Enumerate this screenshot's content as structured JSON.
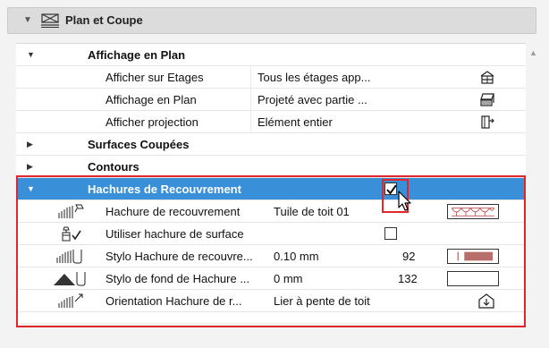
{
  "panel": {
    "title": "Plan et Coupe",
    "icon": "plan-section-icon"
  },
  "groups": {
    "affichage": "Affichage en Plan",
    "surfaces": "Surfaces Coupées",
    "contours": "Contours",
    "hachures": "Hachures de Recouvrement"
  },
  "affichage_rows": [
    {
      "label": "Afficher sur Etages",
      "value": "Tous les étages app...",
      "icon": "all-floors-icon"
    },
    {
      "label": "Affichage en Plan",
      "value": "Projeté avec partie ...",
      "icon": "projected-view-icon"
    },
    {
      "label": "Afficher projection",
      "value": "Elément entier",
      "icon": "entire-element-icon"
    }
  ],
  "hachures_checked": true,
  "hachures_rows": [
    {
      "label": "Hachure de recouvrement",
      "value": "Tuile de toit 01",
      "extra": "",
      "icon": "cover-fill-icon",
      "swatch": "roof-tile-pattern"
    },
    {
      "label": "Utiliser hachure de surface",
      "value": "",
      "extra": "",
      "icon": "use-surface-fill-icon",
      "checked": false
    },
    {
      "label": "Stylo Hachure de recouvre...",
      "value": "0.10 mm",
      "extra": "92",
      "icon": "fill-pen-icon",
      "color": "#b86f6b"
    },
    {
      "label": "Stylo de fond de Hachure ...",
      "value": "0 mm",
      "extra": "132",
      "icon": "fill-background-pen-icon",
      "color": "#ffffff"
    },
    {
      "label": "Orientation Hachure de r...",
      "value": "Lier à pente de toit",
      "extra": "",
      "icon": "fill-orientation-icon"
    }
  ],
  "colors": {
    "selection": "#3a8fd9",
    "highlight_frame": "#e0262a",
    "tile_pattern": "#c05050"
  }
}
